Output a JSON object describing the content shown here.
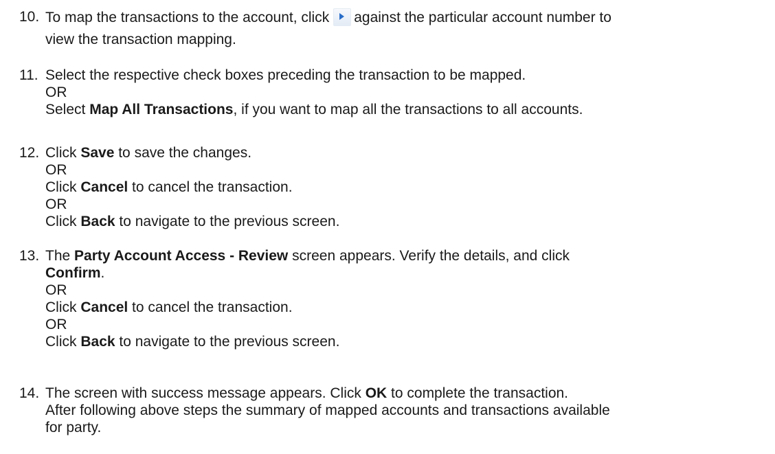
{
  "steps": [
    {
      "number": "10.",
      "lines": [
        {
          "before": "To map the transactions to the account, click",
          "icon": "expand-arrow-icon",
          "after": "against the particular account number to"
        },
        {
          "text": "view the transaction mapping."
        }
      ]
    },
    {
      "number": "11.",
      "lines": [
        {
          "text": "Select the respective check boxes preceding the transaction to be mapped."
        },
        {
          "text": "OR"
        },
        {
          "pre": "Select ",
          "bold": "Map All Transactions",
          "post": ", if you want to map all the transactions to all accounts."
        }
      ]
    },
    {
      "number": "12.",
      "lines": [
        {
          "pre": "Click ",
          "bold": "Save",
          "post": " to save the changes."
        },
        {
          "text": "OR"
        },
        {
          "pre": "Click ",
          "bold": "Cancel",
          "post": " to cancel the transaction."
        },
        {
          "text": "OR"
        },
        {
          "pre": "Click ",
          "bold": "Back",
          "post": " to navigate to the previous screen."
        }
      ]
    },
    {
      "number": "13.",
      "lines": [
        {
          "pre": "The ",
          "bold": "Party Account Access - Review",
          "post": " screen appears. Verify the details, and click"
        },
        {
          "pre": "",
          "bold": "Confirm",
          "post": "."
        },
        {
          "text": "OR"
        },
        {
          "pre": "Click ",
          "bold": "Cancel",
          "post": " to cancel the transaction."
        },
        {
          "text": "OR"
        },
        {
          "pre": "Click ",
          "bold": "Back",
          "post": " to navigate to the previous screen."
        }
      ]
    },
    {
      "number": "14.",
      "lines": [
        {
          "pre": "The screen with success message appears. Click ",
          "bold": "OK",
          "post": " to complete the transaction."
        },
        {
          "text": "After following above steps the summary of mapped accounts and transactions available"
        },
        {
          "text": "for party."
        }
      ]
    }
  ]
}
